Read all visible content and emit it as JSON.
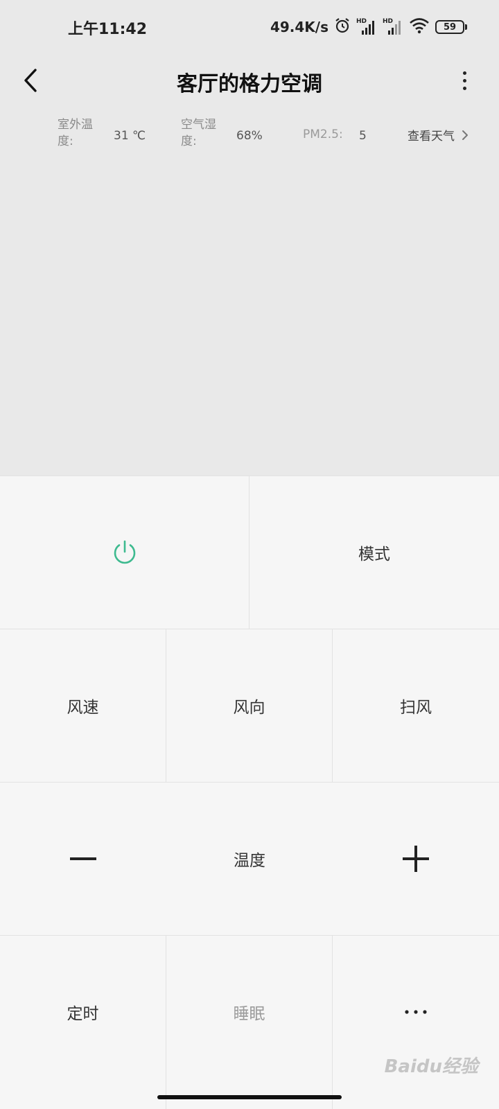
{
  "status_bar": {
    "time": "上午11:42",
    "net_speed": "49.4K/s",
    "sim1_label": "HD",
    "sim2_label": "HD",
    "battery": "59"
  },
  "header": {
    "title": "客厅的格力空调"
  },
  "weather": {
    "outdoor_temp_label": "室外温度:",
    "outdoor_temp_value": "31 ℃",
    "humidity_label": "空气湿度:",
    "humidity_value": "68%",
    "pm25_label": "PM2.5:",
    "pm25_value": "5",
    "view_weather": "查看天气"
  },
  "controls": {
    "mode": "模式",
    "wind_speed": "风速",
    "wind_direction": "风向",
    "swing": "扫风",
    "temperature": "温度",
    "timer": "定时",
    "sleep": "睡眠"
  },
  "colors": {
    "power_green": "#3dba8f",
    "top_bg": "#e9e9e9",
    "grid_bg": "#f6f6f6"
  },
  "icons": [
    "back-arrow-icon",
    "more-vertical-icon",
    "power-icon",
    "minus-icon",
    "plus-icon",
    "ellipsis-icon",
    "chevron-right-icon",
    "alarm-icon",
    "wifi-icon",
    "signal-icon"
  ],
  "watermark": "Baidu经验"
}
